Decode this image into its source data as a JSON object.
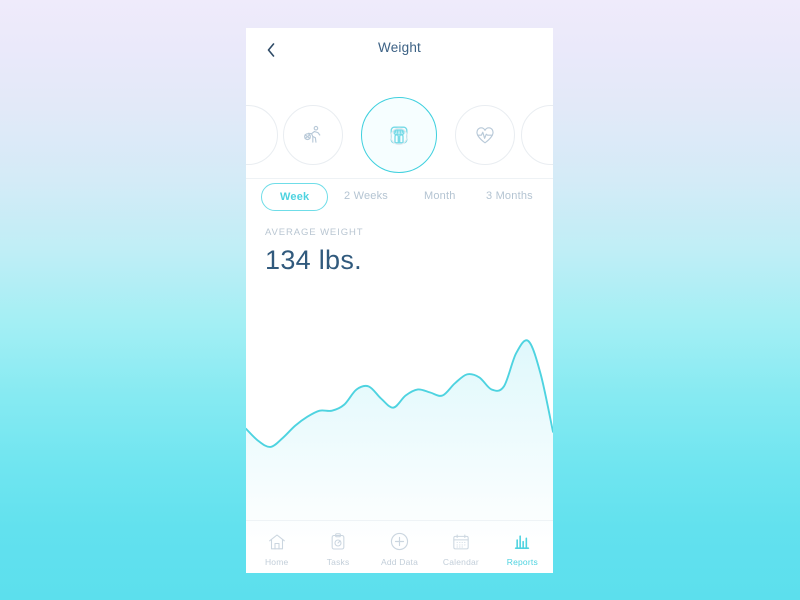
{
  "theme": {
    "accent": "#4ed3e0",
    "accent_line": "#3fd0de",
    "title_text": "#3d6285",
    "value_text": "#315a7d",
    "muted_text": "#b4c4d2",
    "card_bg": "#ffffff",
    "page_gradient_top": "#efebfb",
    "page_gradient_bottom": "#5cdfed"
  },
  "header": {
    "back_icon": "chevron-left-icon",
    "title": "Weight"
  },
  "categories": {
    "items": [
      {
        "id": "edge-left",
        "icon": "partial-circle-icon",
        "label": "",
        "selected": false,
        "partial": true
      },
      {
        "id": "cat-1",
        "icon": "running-person-icon",
        "label": "",
        "selected": false,
        "partial": false
      },
      {
        "id": "cat-2",
        "icon": "weight-scale-icon",
        "label": "",
        "selected": true,
        "partial": false
      },
      {
        "id": "cat-3",
        "icon": "heart-pulse-icon",
        "label": "",
        "selected": false,
        "partial": false
      },
      {
        "id": "edge-right",
        "icon": "partial-circle-icon",
        "label": "",
        "selected": false,
        "partial": true
      }
    ]
  },
  "range_tabs": {
    "items": [
      {
        "label": "Week",
        "selected": true
      },
      {
        "label": "2 Weeks",
        "selected": false
      },
      {
        "label": "Month",
        "selected": false
      },
      {
        "label": "3 Months",
        "selected": false
      }
    ]
  },
  "summary": {
    "label": "AVERAGE WEIGHT",
    "value": "134 lbs."
  },
  "chart_data": {
    "type": "area",
    "title": "",
    "subtitle": "",
    "xlabel": "",
    "ylabel": "",
    "grid": false,
    "legend": null,
    "line_color": "#4ed3e0",
    "fill_top_color": "#e4fafd",
    "fill_bottom_color": "#ffffff",
    "series": [
      {
        "name": "Weight",
        "units": "lbs.",
        "x": [
          0,
          3,
          7,
          12,
          17,
          22,
          26,
          30,
          34,
          38,
          42,
          46,
          50,
          54,
          58,
          62,
          66,
          70,
          74,
          78,
          82,
          86,
          90,
          94,
          100
        ],
        "values": [
          134,
          130,
          128,
          131,
          135,
          138,
          140,
          140,
          142,
          147,
          148,
          144,
          141,
          145,
          147,
          146,
          145,
          149,
          152,
          151,
          147,
          148,
          159,
          163,
          152,
          133
        ]
      }
    ],
    "ylim": [
      125,
      168
    ],
    "average": 134
  },
  "bottom_nav": {
    "items": [
      {
        "label": "Home",
        "icon": "home-icon",
        "active": false
      },
      {
        "label": "Tasks",
        "icon": "clipboard-icon",
        "active": false
      },
      {
        "label": "Add Data",
        "icon": "plus-circle-icon",
        "active": false
      },
      {
        "label": "Calendar",
        "icon": "calendar-icon",
        "active": false
      },
      {
        "label": "Reports",
        "icon": "bar-chart-icon",
        "active": true
      }
    ]
  }
}
